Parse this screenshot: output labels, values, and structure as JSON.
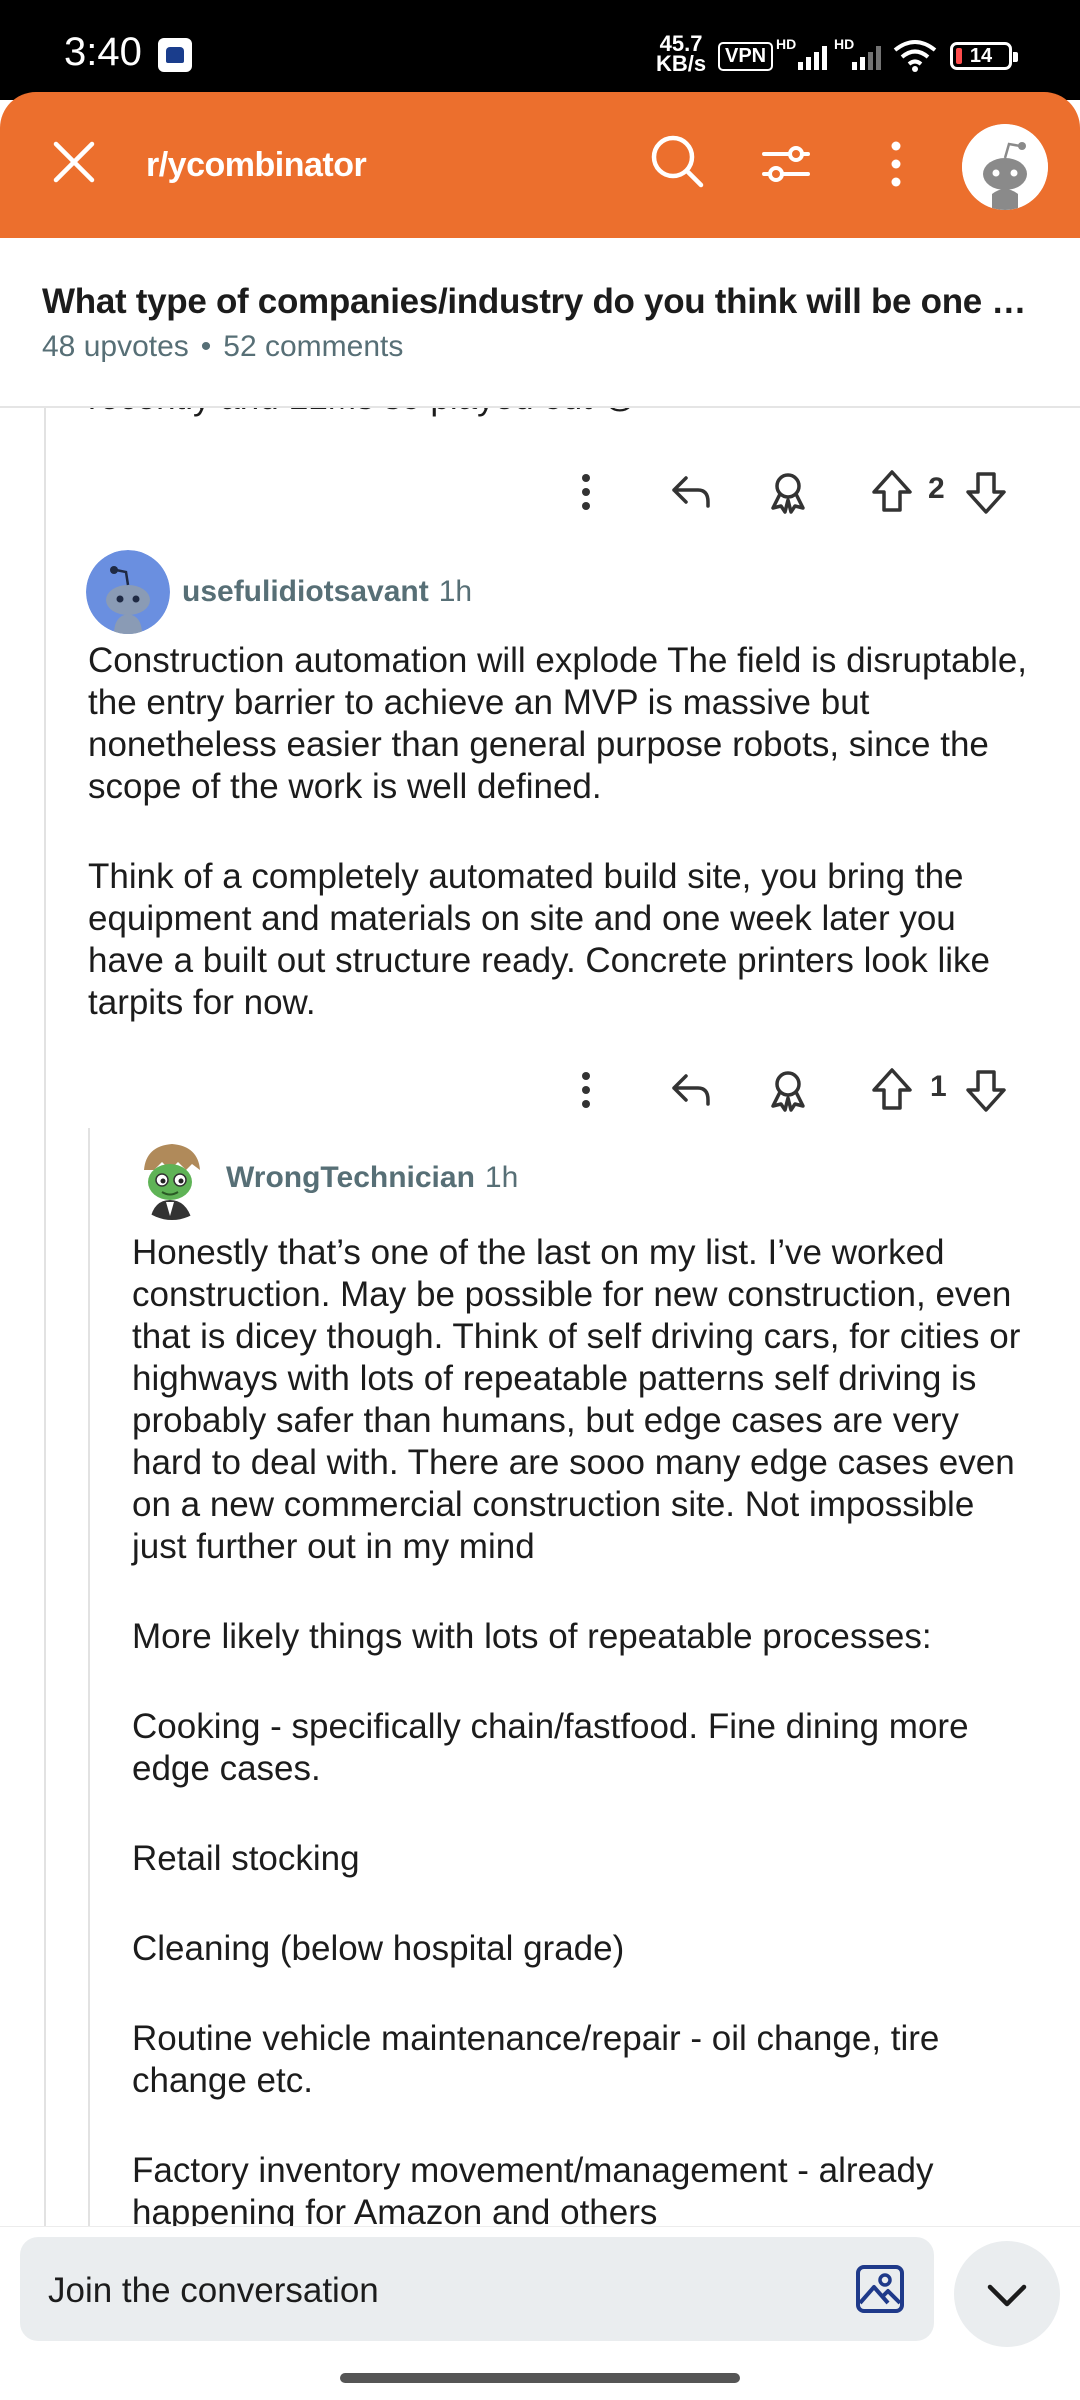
{
  "status_bar": {
    "time": "3:40",
    "net_speed_value": "45.7",
    "net_speed_unit": "KB/s",
    "vpn": "VPN",
    "sim1": "HD",
    "sim2": "HD",
    "battery": "14"
  },
  "app_bar": {
    "subreddit": "r/ycombinator",
    "accent_color": "#EC6F2D"
  },
  "post": {
    "title": "What type of companies/industry do you think will be one of...",
    "upvotes": "48 upvotes",
    "separator": "•",
    "comments": "52 comments"
  },
  "comments": [
    {
      "cut_text": "recently and LLMs so played out 😟",
      "score": "2"
    },
    {
      "author": "usefulidiotsavant",
      "time": "1h",
      "paragraphs": [
        "Construction automation will explode The field is disruptable, the entry barrier to achieve an MVP is massive but nonetheless easier than general purpose robots, since the scope of the work is well defined.",
        "Think of a completely automated build site, you bring the equipment and materials on site and one week later you have a built out structure ready. Concrete printers look like tarpits for now."
      ],
      "score": "1"
    },
    {
      "author": "WrongTechnician",
      "time": "1h",
      "paragraphs": [
        "Honestly that’s one of the last on my list. I’ve worked construction. May be possible for new construction, even that is dicey though. Think of self driving cars, for cities or highways with lots of repeatable patterns self driving is probably safer than humans, but edge cases are very hard to deal with. There are sooo many edge cases even on a new commercial construction site. Not impossible just further out in my mind",
        "More likely things with lots of repeatable processes:",
        "Cooking - specifically chain/fastfood. Fine dining more edge cases.",
        "Retail stocking",
        "Cleaning (below hospital grade)",
        "Routine vehicle maintenance/repair - oil change, tire change etc.",
        "Factory inventory movement/management - already happening for Amazon and others"
      ]
    }
  ],
  "bottom_bar": {
    "placeholder": "Join the conversation"
  }
}
